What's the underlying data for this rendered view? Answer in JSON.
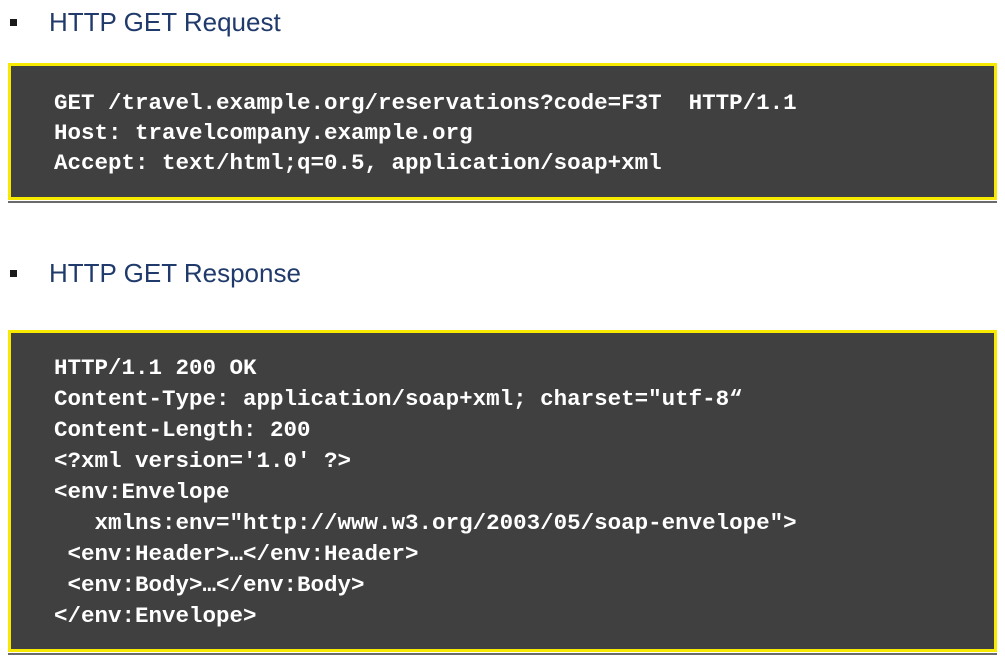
{
  "request": {
    "heading": "HTTP GET Request",
    "lines": [
      "GET /travel.example.org/reservations?code=F3T  HTTP/1.1",
      "Host: travelcompany.example.org",
      "Accept: text/html;q=0.5, application/soap+xml"
    ]
  },
  "response": {
    "heading": "HTTP GET Response",
    "lines": [
      "HTTP/1.1 200 OK",
      "Content-Type: application/soap+xml; charset=\"utf-8“",
      "Content-Length: 200",
      "<?xml version='1.0' ?>",
      "<env:Envelope",
      "   xmlns:env=\"http://www.w3.org/2003/05/soap-envelope\">",
      " <env:Header>…</env:Header>",
      " <env:Body>…</env:Body>",
      "</env:Envelope>"
    ]
  },
  "colors": {
    "code_background": "#404040",
    "code_border": "#f7ea00",
    "heading_text": "#1f3a6b",
    "code_text": "#ffffff"
  }
}
